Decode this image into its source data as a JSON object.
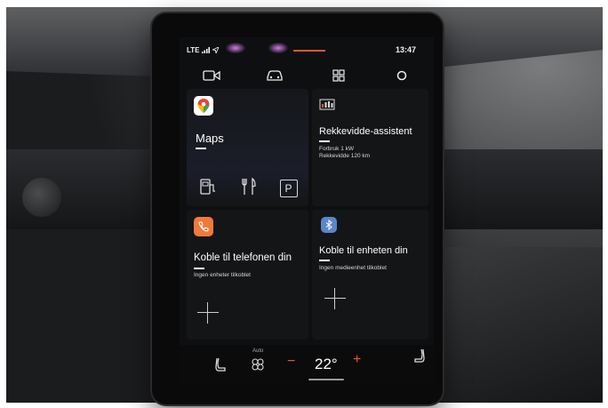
{
  "status": {
    "network": "LTE",
    "time": "13:47"
  },
  "nav": {
    "icons": [
      "camera-icon",
      "car-icon",
      "grid-icon",
      "circle-icon"
    ]
  },
  "tiles": {
    "maps": {
      "title": "Maps",
      "icon": "google-maps-icon",
      "shortcuts": [
        "ev-charging-icon",
        "restaurant-icon",
        "parking-icon"
      ],
      "parking_label": "P"
    },
    "range": {
      "title": "Rekkevidde-assistent",
      "line1": "Forbruk 1 kW",
      "line2": "Rekkevidde 120 km",
      "icon": "battery-gauge-icon"
    },
    "phone": {
      "title": "Koble til telefonen din",
      "subtitle": "Ingen enheter tilkoblet",
      "icon": "phone-icon",
      "icon_color": "#f07a3a"
    },
    "device": {
      "title": "Koble til enheten din",
      "subtitle": "Ingen medieenhet tilkoblet",
      "icon": "bluetooth-icon",
      "icon_color": "#5b86c7"
    }
  },
  "climate": {
    "auto_label": "Auto",
    "temp_minus": "−",
    "temperature": "22°",
    "temp_plus": "+"
  },
  "colors": {
    "accent": "#e8572a",
    "screen_bg": "#0e0f11",
    "text": "#f2f2f2"
  }
}
